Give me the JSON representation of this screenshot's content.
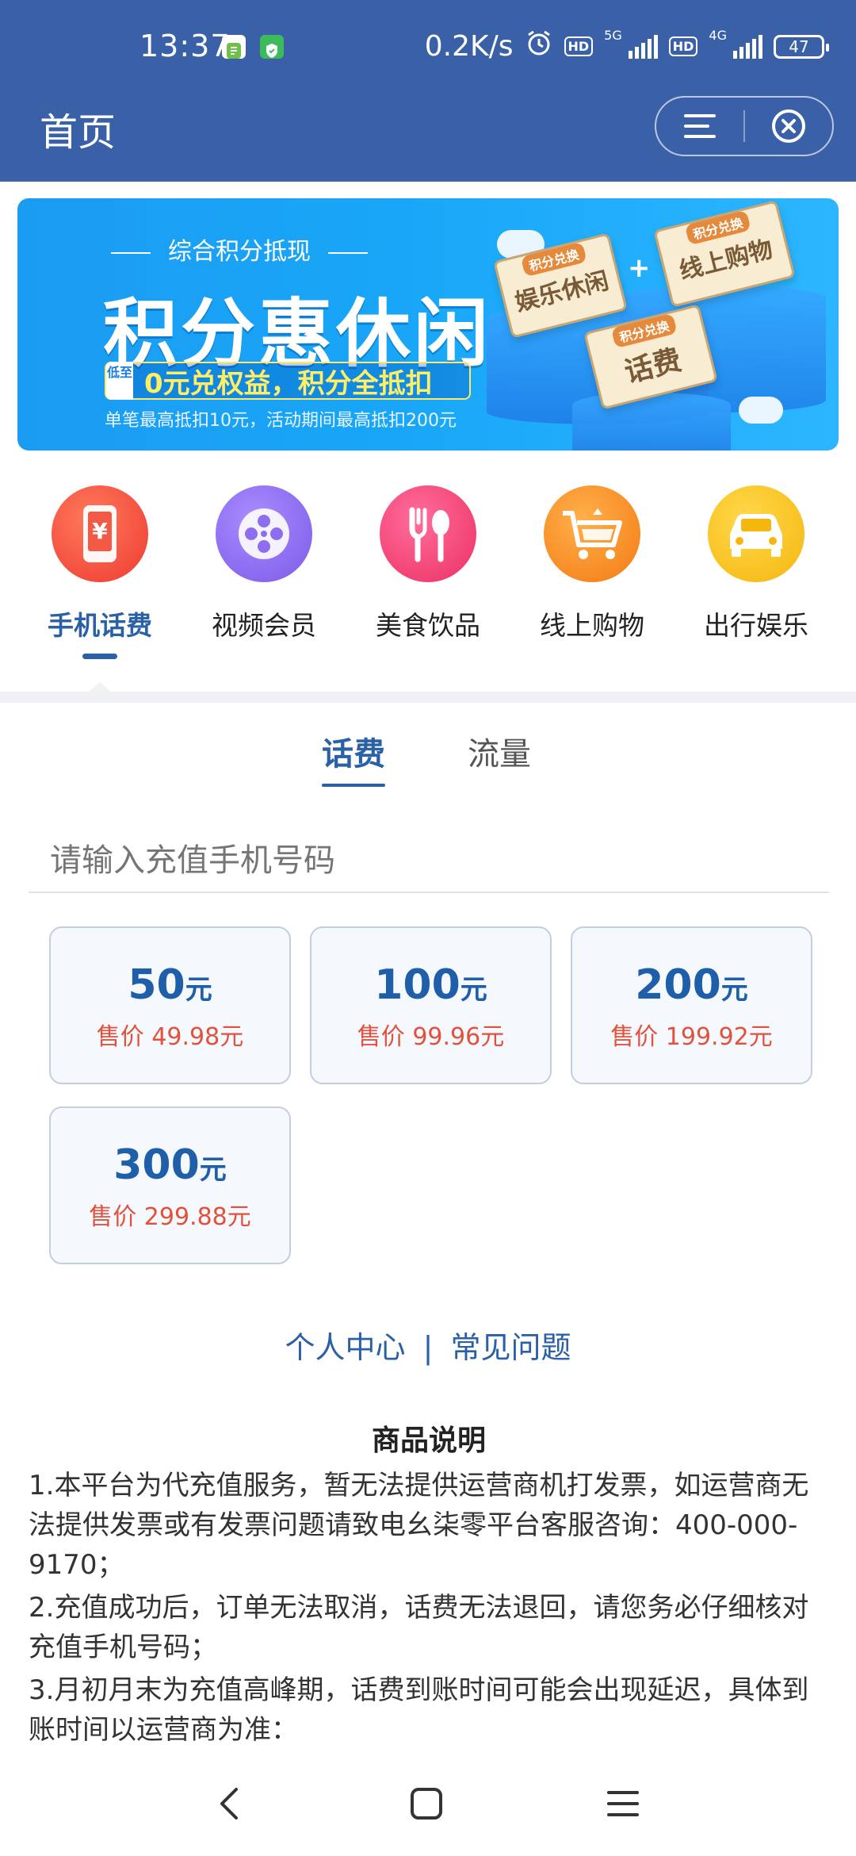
{
  "status_bar": {
    "time": "13:37",
    "speed": "0.2K/s",
    "hd1": "HD",
    "net1": "5G",
    "hd2": "HD",
    "net2": "4G",
    "battery": "47"
  },
  "header": {
    "title": "首页",
    "menu_icon": "menu-icon",
    "close_icon": "close-icon"
  },
  "banner": {
    "subtitle": "综合积分抵现",
    "headline": "积分惠休闲",
    "tag": "低至",
    "highlight": "0元兑权益，积分全抵扣",
    "note": "单笔最高抵扣10元，活动期间最高抵扣200元",
    "card1_small": "积分兑换",
    "card1_text": "娱乐休闲",
    "card2_small": "积分兑换",
    "card2_text": "线上购物",
    "card3_small": "积分兑换",
    "card3_text": "话费",
    "plus": "+"
  },
  "categories": [
    {
      "label": "手机话费",
      "icon": "phone-yuan-icon",
      "color": "#f0463c"
    },
    {
      "label": "视频会员",
      "icon": "film-reel-icon",
      "color": "#8e6ef0"
    },
    {
      "label": "美食饮品",
      "icon": "fork-spoon-icon",
      "color": "#f03c72"
    },
    {
      "label": "线上购物",
      "icon": "shopping-cart-icon",
      "color": "#f7891e"
    },
    {
      "label": "出行娱乐",
      "icon": "car-icon",
      "color": "#f7be14"
    }
  ],
  "tabs": [
    {
      "label": "话费"
    },
    {
      "label": "流量"
    }
  ],
  "phone_input": {
    "placeholder": "请输入充值手机号码"
  },
  "options": [
    {
      "amount": "50",
      "unit": "元",
      "price": "售价 49.98元"
    },
    {
      "amount": "100",
      "unit": "元",
      "price": "售价 99.96元"
    },
    {
      "amount": "200",
      "unit": "元",
      "price": "售价 199.92元"
    },
    {
      "amount": "300",
      "unit": "元",
      "price": "售价 299.88元"
    }
  ],
  "links": {
    "personal": "个人中心",
    "divider": "|",
    "faq": "常见问题"
  },
  "description": {
    "title": "商品说明",
    "items": [
      "1.本平台为代充值服务，暂无法提供运营商机打发票，如运营商无法提供发票或有发票问题请致电幺柒零平台客服咨询：400-000-9170；",
      "2.充值成功后，订单无法取消，话费无法退回，请您务必仔细核对充值手机号码；",
      "3.月初月末为充值高峰期，话费到账时间可能会出现延迟，具体到账时间以运营商为准："
    ]
  },
  "colors": {
    "primary": "#3a61a8",
    "accent": "#2a60a5",
    "price": "#e2513c"
  }
}
